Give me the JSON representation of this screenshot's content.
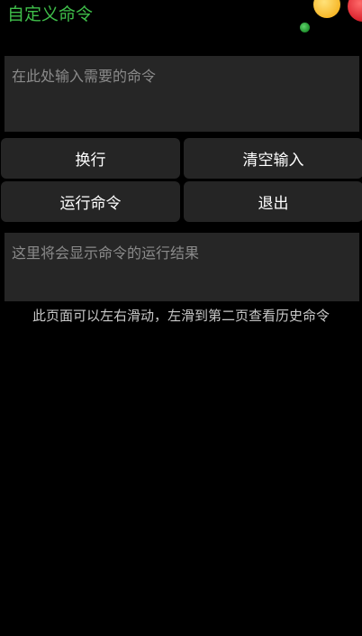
{
  "header": {
    "title": "自定义命令",
    "title_color": "#3fbf4a"
  },
  "decorations": {
    "dot_colors": [
      "#f7b82a",
      "#d81e2a",
      "#1f8f2d"
    ]
  },
  "command_input": {
    "value": "",
    "placeholder": "在此处输入需要的命令"
  },
  "buttons": {
    "newline_label": "换行",
    "clear_label": "清空输入",
    "run_label": "运行命令",
    "exit_label": "退出"
  },
  "result": {
    "placeholder_text": "这里将会显示命令的运行结果"
  },
  "hint": {
    "text": "此页面可以左右滑动，左滑到第二页查看历史命令"
  }
}
